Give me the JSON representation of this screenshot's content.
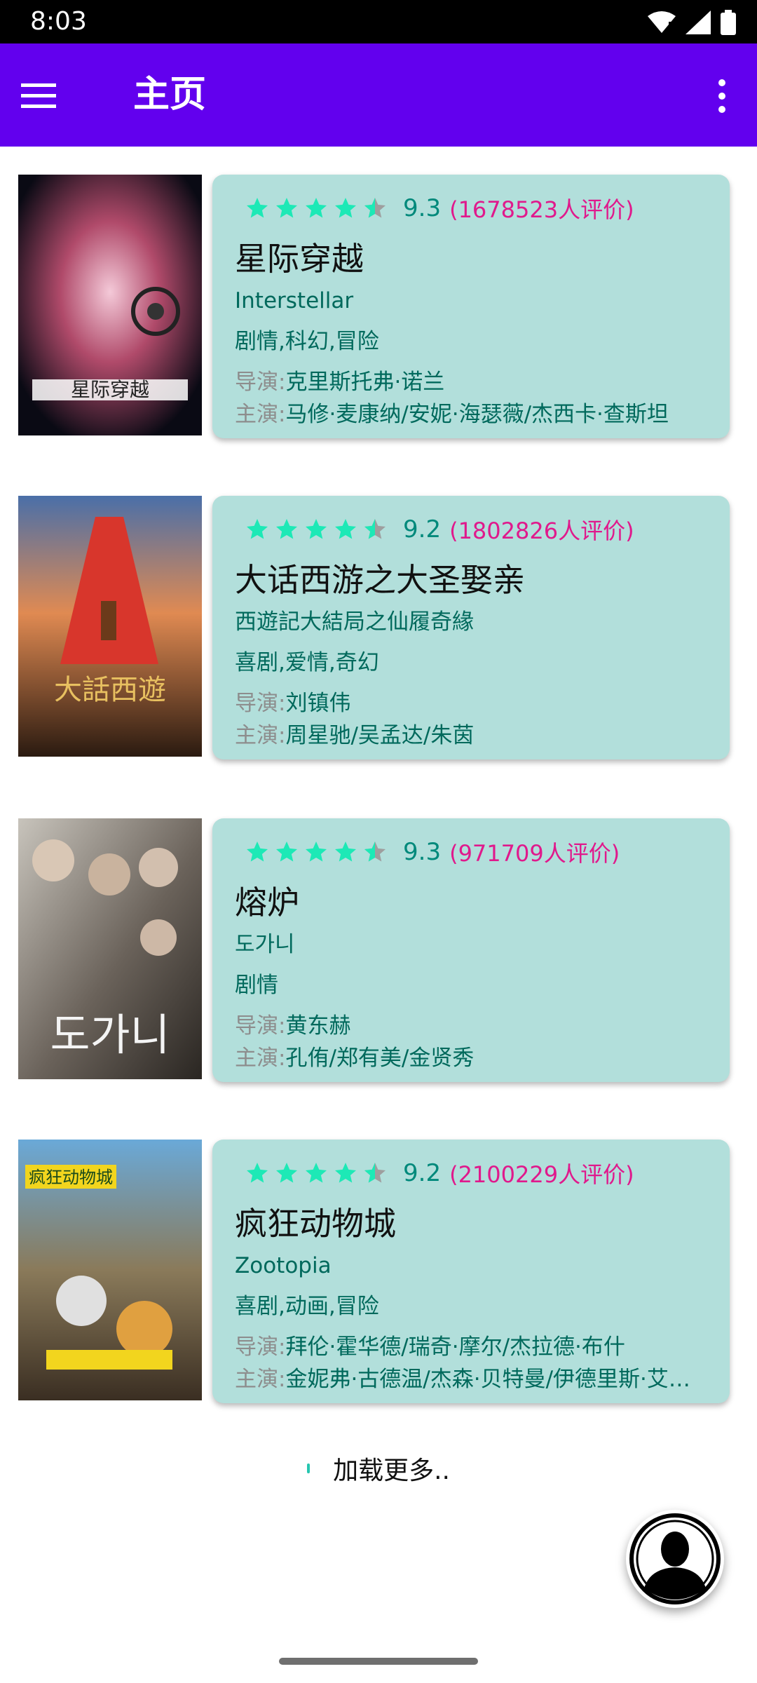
{
  "status_bar": {
    "time": "8:03"
  },
  "app_bar": {
    "title": "主页"
  },
  "movies": [
    {
      "rating_stars": 4.5,
      "score": "9.3",
      "votes": "(1678523人评价)",
      "title": "星际穿越",
      "original_title": "Interstellar",
      "genres": "剧情,科幻,冒险",
      "director_label": "导演:",
      "director": "克里斯托弗·诺兰",
      "cast_label": "主演:",
      "cast": "马修·麦康纳/安妮·海瑟薇/杰西卡·查斯坦",
      "poster_text": "星际穿越"
    },
    {
      "rating_stars": 4.5,
      "score": "9.2",
      "votes": "(1802826人评价)",
      "title": "大话西游之大圣娶亲",
      "original_title": "西遊記大結局之仙履奇緣",
      "genres": "喜剧,爱情,奇幻",
      "director_label": "导演:",
      "director": "刘镇伟",
      "cast_label": "主演:",
      "cast": "周星驰/吴孟达/朱茵",
      "poster_text": "大話西遊"
    },
    {
      "rating_stars": 4.5,
      "score": "9.3",
      "votes": "(971709人评价)",
      "title": "熔炉",
      "original_title": "도가니",
      "genres": "剧情",
      "director_label": "导演:",
      "director": "黄东赫",
      "cast_label": "主演:",
      "cast": "孔侑/郑有美/金贤秀",
      "poster_text": "도가니"
    },
    {
      "rating_stars": 4.5,
      "score": "9.2",
      "votes": "(2100229人评价)",
      "title": "疯狂动物城",
      "original_title": "Zootopia",
      "genres": "喜剧,动画,冒险",
      "director_label": "导演:",
      "director": "拜伦·霍华德/瑞奇·摩尔/杰拉德·布什",
      "cast_label": "主演:",
      "cast": "金妮弗·古德温/杰森·贝特曼/伊德里斯·艾…",
      "poster_text": "疯狂动物城"
    }
  ],
  "load_more": {
    "label": "加载更多.."
  },
  "colors": {
    "app_bar": "#6200ee",
    "card": "#b2dfdb",
    "star": "#1de9b6",
    "votes": "#e0198c"
  }
}
